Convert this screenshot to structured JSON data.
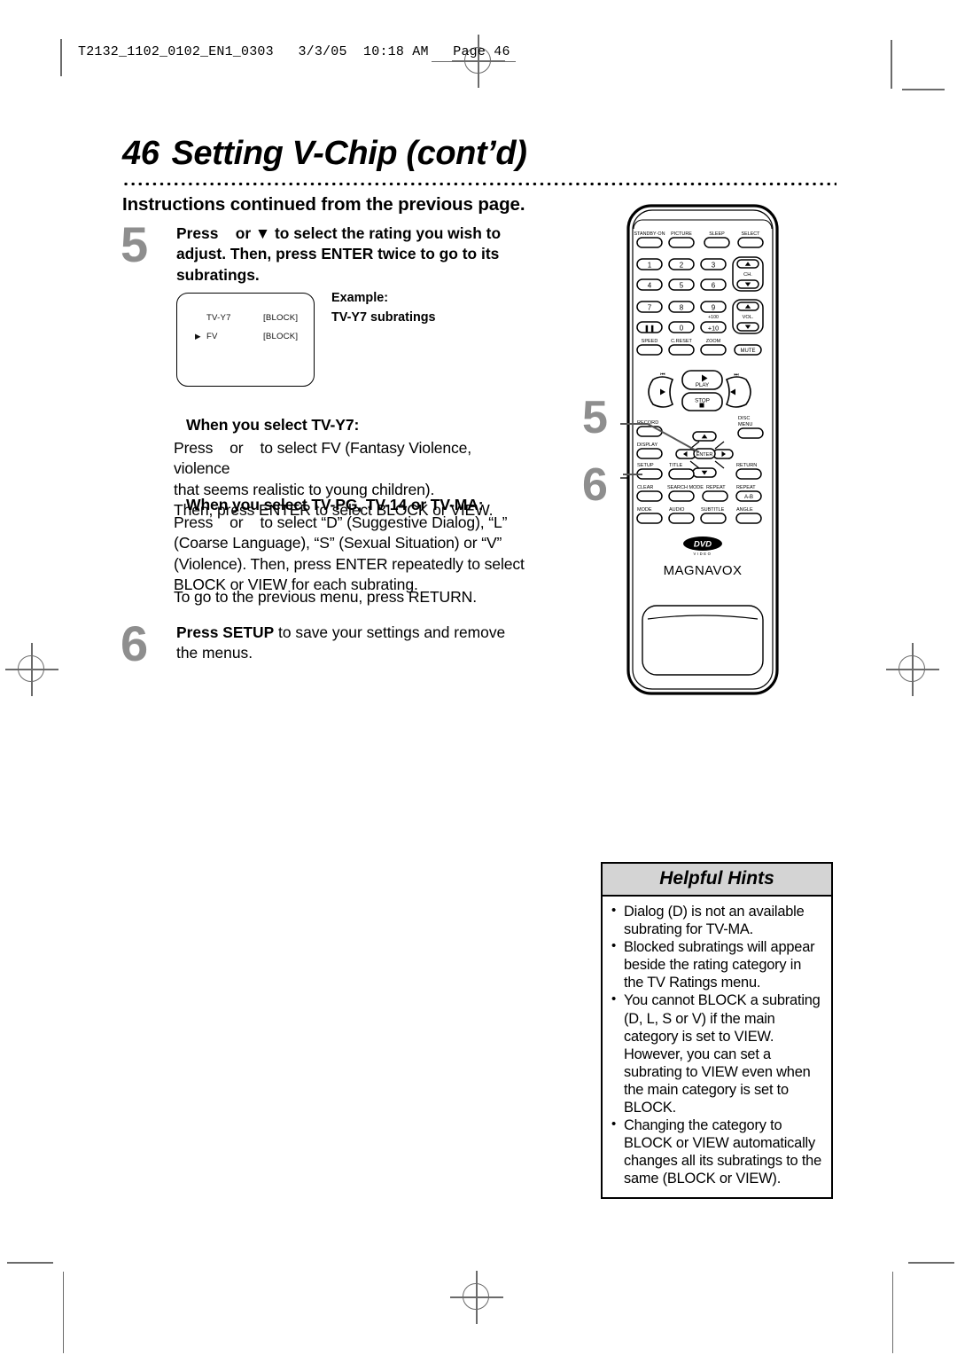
{
  "page": {
    "slug": "T2132_1102_0102_EN1_0303   3/3/05  10:18 AM   Page 46",
    "number": "46",
    "title": "Setting V-Chip (cont’d)",
    "subhead": "Instructions continued from the previous page."
  },
  "steps": [
    {
      "number": "5",
      "text_html": "Press    or ▼ to select the rating you wish to adjust. Then, press ENTER twice to go to its subratings."
    },
    {
      "number": "6",
      "bold_lead": "Press SETUP",
      "rest": " to save your settings and remove the menus."
    }
  ],
  "example": {
    "label": "Example:",
    "caption": "TV-Y7 subratings",
    "screen_rows": [
      {
        "marker": "",
        "name": "TV-Y7",
        "value": "[BLOCK]"
      },
      {
        "marker": "▶",
        "name": "FV",
        "value": "[BLOCK]"
      }
    ]
  },
  "body": {
    "tvy7_head": "When you select TV-Y7:",
    "tvy7_text": "Press    or    to select FV (Fantasy Violence, violence that seems realistic to young children). Then, press ENTER to select BLOCK or VIEW.",
    "tvpg_head": "When you select TV-PG, TV-14 or TV-MA:",
    "tvpg_text": "Press    or    to select “D” (Suggestive Dialog), “L” (Coarse Language), “S” (Sexual Situation) or “V” (Violence). Then, press ENTER repeatedly to select BLOCK or VIEW for each subrating.",
    "return_text": "To go to the previous menu, press RETURN."
  },
  "hints": {
    "heading": "Helpful Hints",
    "items": [
      "Dialog (D) is not an available subrating for TV-MA.",
      "Blocked subratings will appear beside the rating category in the TV Ratings menu.",
      "You cannot BLOCK a subrating (D, L, S or V) if the main category is set to VIEW. However, you can set a subrating to VIEW even when the main category is set to BLOCK.",
      "Changing the category to BLOCK or VIEW automatically changes all its subratings to the same (BLOCK or VIEW)."
    ]
  },
  "callouts": [
    {
      "number": "5",
      "target": "enter-button"
    },
    {
      "number": "6",
      "target": "setup-button"
    }
  ],
  "remote": {
    "brand": "MAGNAVOX",
    "logo": "DVD",
    "logo_sub": "VIDEO",
    "row_top": [
      "STANDBY·ON",
      "PICTURE",
      "SLEEP",
      "SELECT"
    ],
    "keypad": [
      "1",
      "2",
      "3",
      "4",
      "5",
      "6",
      "7",
      "8",
      "9",
      "Ⅱ",
      "0",
      "+10"
    ],
    "plus100": "+100",
    "ch_label": "CH.",
    "vol_label": "VOL.",
    "row_speed": [
      "SPEED",
      "C.RESET",
      "ZOOM"
    ],
    "mute": "MUTE",
    "transport": [
      "◀◀",
      "▶",
      "▶▶",
      "STOP",
      "PLAY"
    ],
    "skip_prev": "⏮",
    "skip_next": "⏭",
    "row_record": [
      "RECORD",
      "DISC MENU"
    ],
    "row_display": [
      "DISPLAY"
    ],
    "row_setup": [
      "SETUP",
      "TITLE",
      "RETURN"
    ],
    "enter": "ENTER",
    "row_clear": [
      "CLEAR",
      "SEARCH MODE",
      "REPEAT",
      "REPEAT A-B"
    ],
    "row_mode": [
      "MODE",
      "AUDIO",
      "SUBTITLE",
      "ANGLE"
    ]
  }
}
